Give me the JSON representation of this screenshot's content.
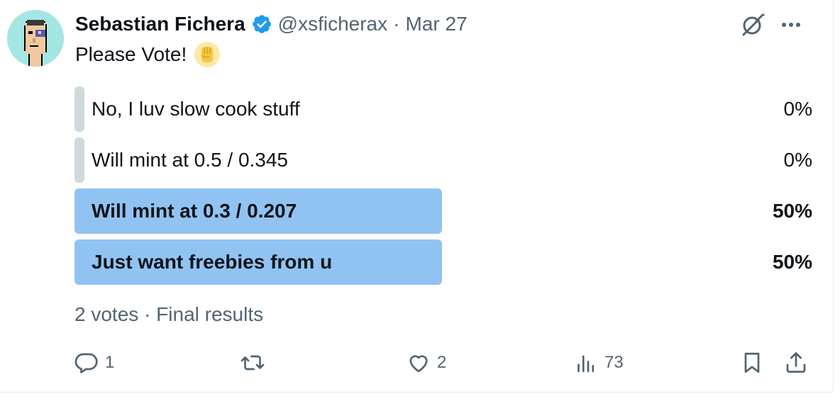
{
  "author": {
    "name": "Sebastian Fichera",
    "handle": "@xsficherax",
    "separator": "·",
    "date": "Mar 27",
    "verified_color": "#1d9bf0"
  },
  "icons": {
    "top_right": [
      "grok-icon",
      "more-icon"
    ],
    "avatar": "pixel-punk-avatar"
  },
  "tweet": {
    "text": "Please Vote!",
    "emoji": "raised-fist-emoji"
  },
  "poll": {
    "options": [
      {
        "label": "No, I luv slow cook stuff",
        "percent": "0%",
        "value": 0,
        "winner": false
      },
      {
        "label": "Will mint at 0.5 / 0.345",
        "percent": "0%",
        "value": 0,
        "winner": false
      },
      {
        "label": "Will mint at 0.3 / 0.207",
        "percent": "50%",
        "value": 0.5,
        "winner": true
      },
      {
        "label": "Just want freebies from u",
        "percent": "50%",
        "value": 0.5,
        "winner": true
      }
    ],
    "votes": "2 votes",
    "separator": "·",
    "status": "Final results",
    "winner_color": "#91c3f2",
    "empty_color": "#cfd9de"
  },
  "actions": {
    "replies": "1",
    "retweets": "",
    "likes": "2",
    "views": "73"
  }
}
